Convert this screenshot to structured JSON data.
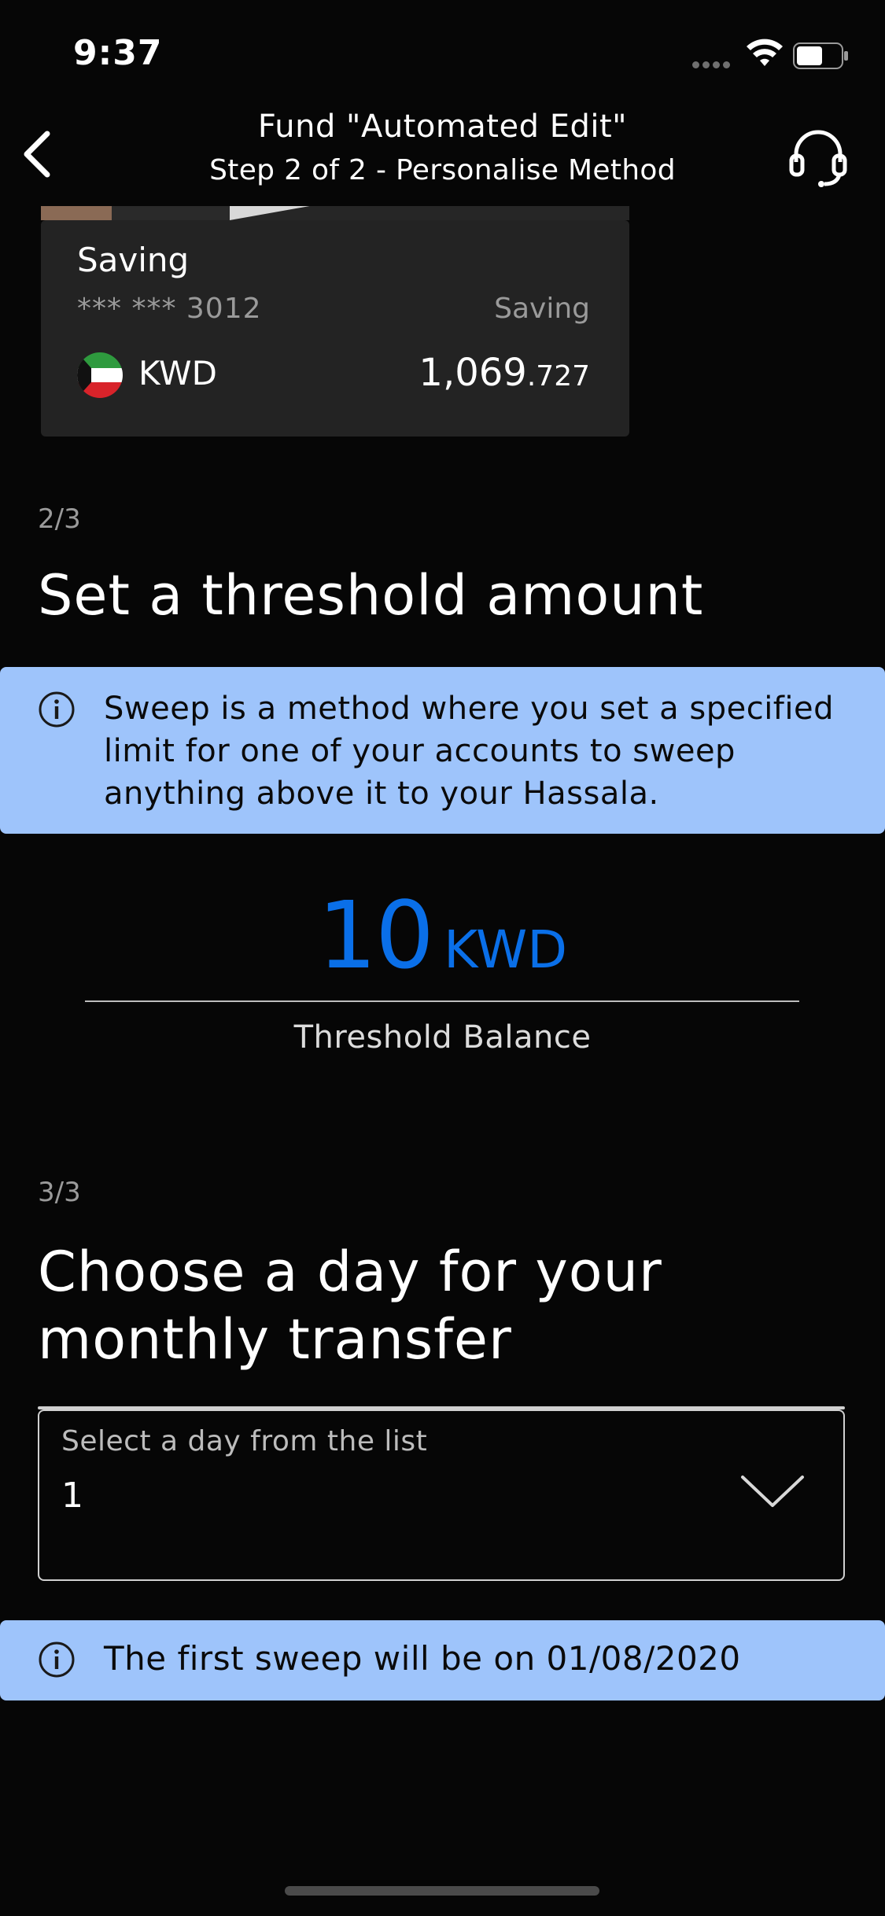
{
  "status_bar": {
    "time": "9:37"
  },
  "header": {
    "title": "Fund \"Automated Edit\"",
    "subtitle": "Step 2 of 2 - Personalise Method"
  },
  "account_card": {
    "name": "Saving",
    "masked_number": "*** *** 3012",
    "type": "Saving",
    "currency": "KWD",
    "balance_main": "1,069",
    "balance_decimal": ".727"
  },
  "step2": {
    "counter": "2/3",
    "title": "Set a threshold amount",
    "info": "Sweep is a method where you set a specified limit for one of your accounts to sweep anything above it to your Hassala.",
    "threshold_value": "10",
    "threshold_currency": "KWD",
    "threshold_label": "Threshold Balance"
  },
  "step3": {
    "counter": "3/3",
    "title_line1": "Choose a day for your",
    "title_line2": "monthly transfer",
    "select_label": "Select a day from the list",
    "select_value": "1",
    "info": "The first sweep will be on 01/08/2020"
  },
  "colors": {
    "background": "#060606",
    "accent_blue": "#0a6fe8",
    "info_banner": "#9ec4fb",
    "card_bg": "#232323"
  },
  "icons": {
    "back": "chevron-left-icon",
    "support": "headset-icon",
    "info": "info-circle-icon",
    "dropdown": "chevron-down-icon"
  }
}
